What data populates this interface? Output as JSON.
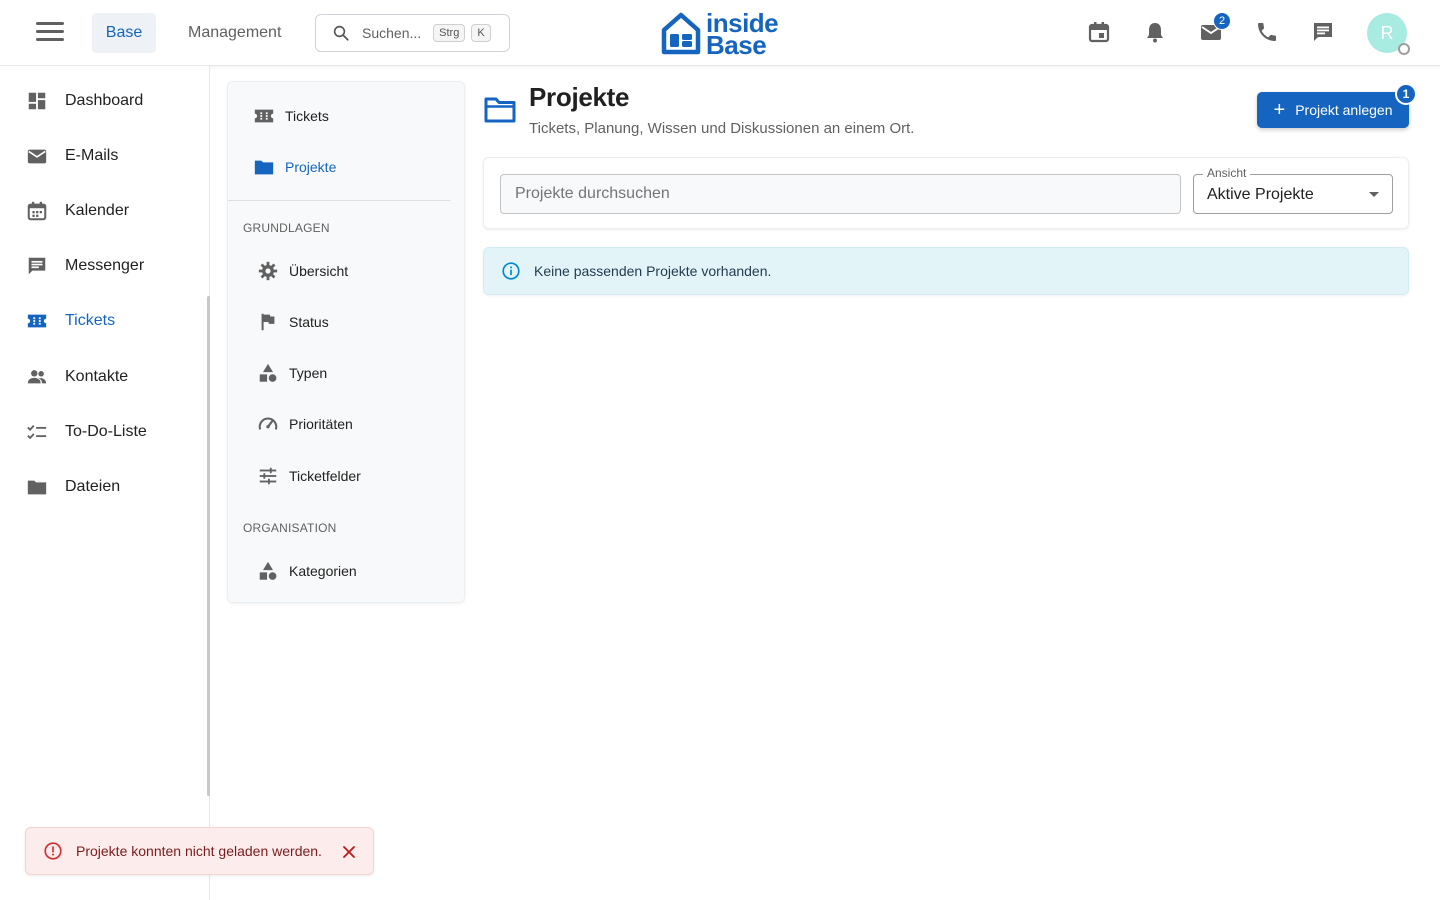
{
  "topbar": {
    "tabs": [
      {
        "label": "Base"
      },
      {
        "label": "Management"
      }
    ],
    "search": {
      "placeholder": "Suchen...",
      "shortcut": [
        "Strg",
        "K"
      ]
    },
    "logo": {
      "line1": "inside",
      "line2": "Base"
    },
    "mail_badge": "2",
    "avatar_initial": "R",
    "icons": [
      "calendar-icon",
      "bell-icon",
      "mail-icon",
      "phone-icon",
      "chat-icon"
    ]
  },
  "sidebar": {
    "items": [
      {
        "label": "Dashboard",
        "icon": "dashboard-icon"
      },
      {
        "label": "E-Mails",
        "icon": "mail-icon"
      },
      {
        "label": "Kalender",
        "icon": "calendar-icon"
      },
      {
        "label": "Messenger",
        "icon": "chat-icon"
      },
      {
        "label": "Tickets",
        "icon": "ticket-icon",
        "active": true
      },
      {
        "label": "Kontakte",
        "icon": "people-icon"
      },
      {
        "label": "To-Do-Liste",
        "icon": "checklist-icon"
      },
      {
        "label": "Dateien",
        "icon": "folder-icon"
      }
    ]
  },
  "subnav": {
    "top_items": [
      {
        "label": "Tickets",
        "icon": "ticket-icon"
      },
      {
        "label": "Projekte",
        "icon": "folder-icon",
        "active": true
      }
    ],
    "sections": [
      {
        "title": "GRUNDLAGEN",
        "items": [
          {
            "label": "Übersicht",
            "icon": "gear-icon"
          },
          {
            "label": "Status",
            "icon": "flag-icon"
          },
          {
            "label": "Typen",
            "icon": "shapes-icon"
          },
          {
            "label": "Prioritäten",
            "icon": "speedometer-icon"
          },
          {
            "label": "Ticketfelder",
            "icon": "sliders-icon"
          }
        ]
      },
      {
        "title": "ORGANISATION",
        "items": [
          {
            "label": "Kategorien",
            "icon": "shapes-icon"
          }
        ]
      }
    ]
  },
  "main": {
    "title": "Projekte",
    "subtitle": "Tickets, Planung, Wissen und Diskussionen an einem Ort.",
    "create_button": {
      "label": "Projekt anlegen",
      "badge": "1"
    },
    "search_placeholder": "Projekte durchsuchen",
    "view_select": {
      "label": "Ansicht",
      "value": "Aktive Projekte"
    },
    "info_message": "Keine passenden Projekte vorhanden."
  },
  "toast": {
    "message": "Projekte konnten nicht geladen werden."
  },
  "colors": {
    "accent": "#1565c0",
    "info_bg": "#e3f4f9",
    "error_bg": "#fdecec",
    "error": "#d32f2f",
    "avatar": "#a7ebe1"
  }
}
